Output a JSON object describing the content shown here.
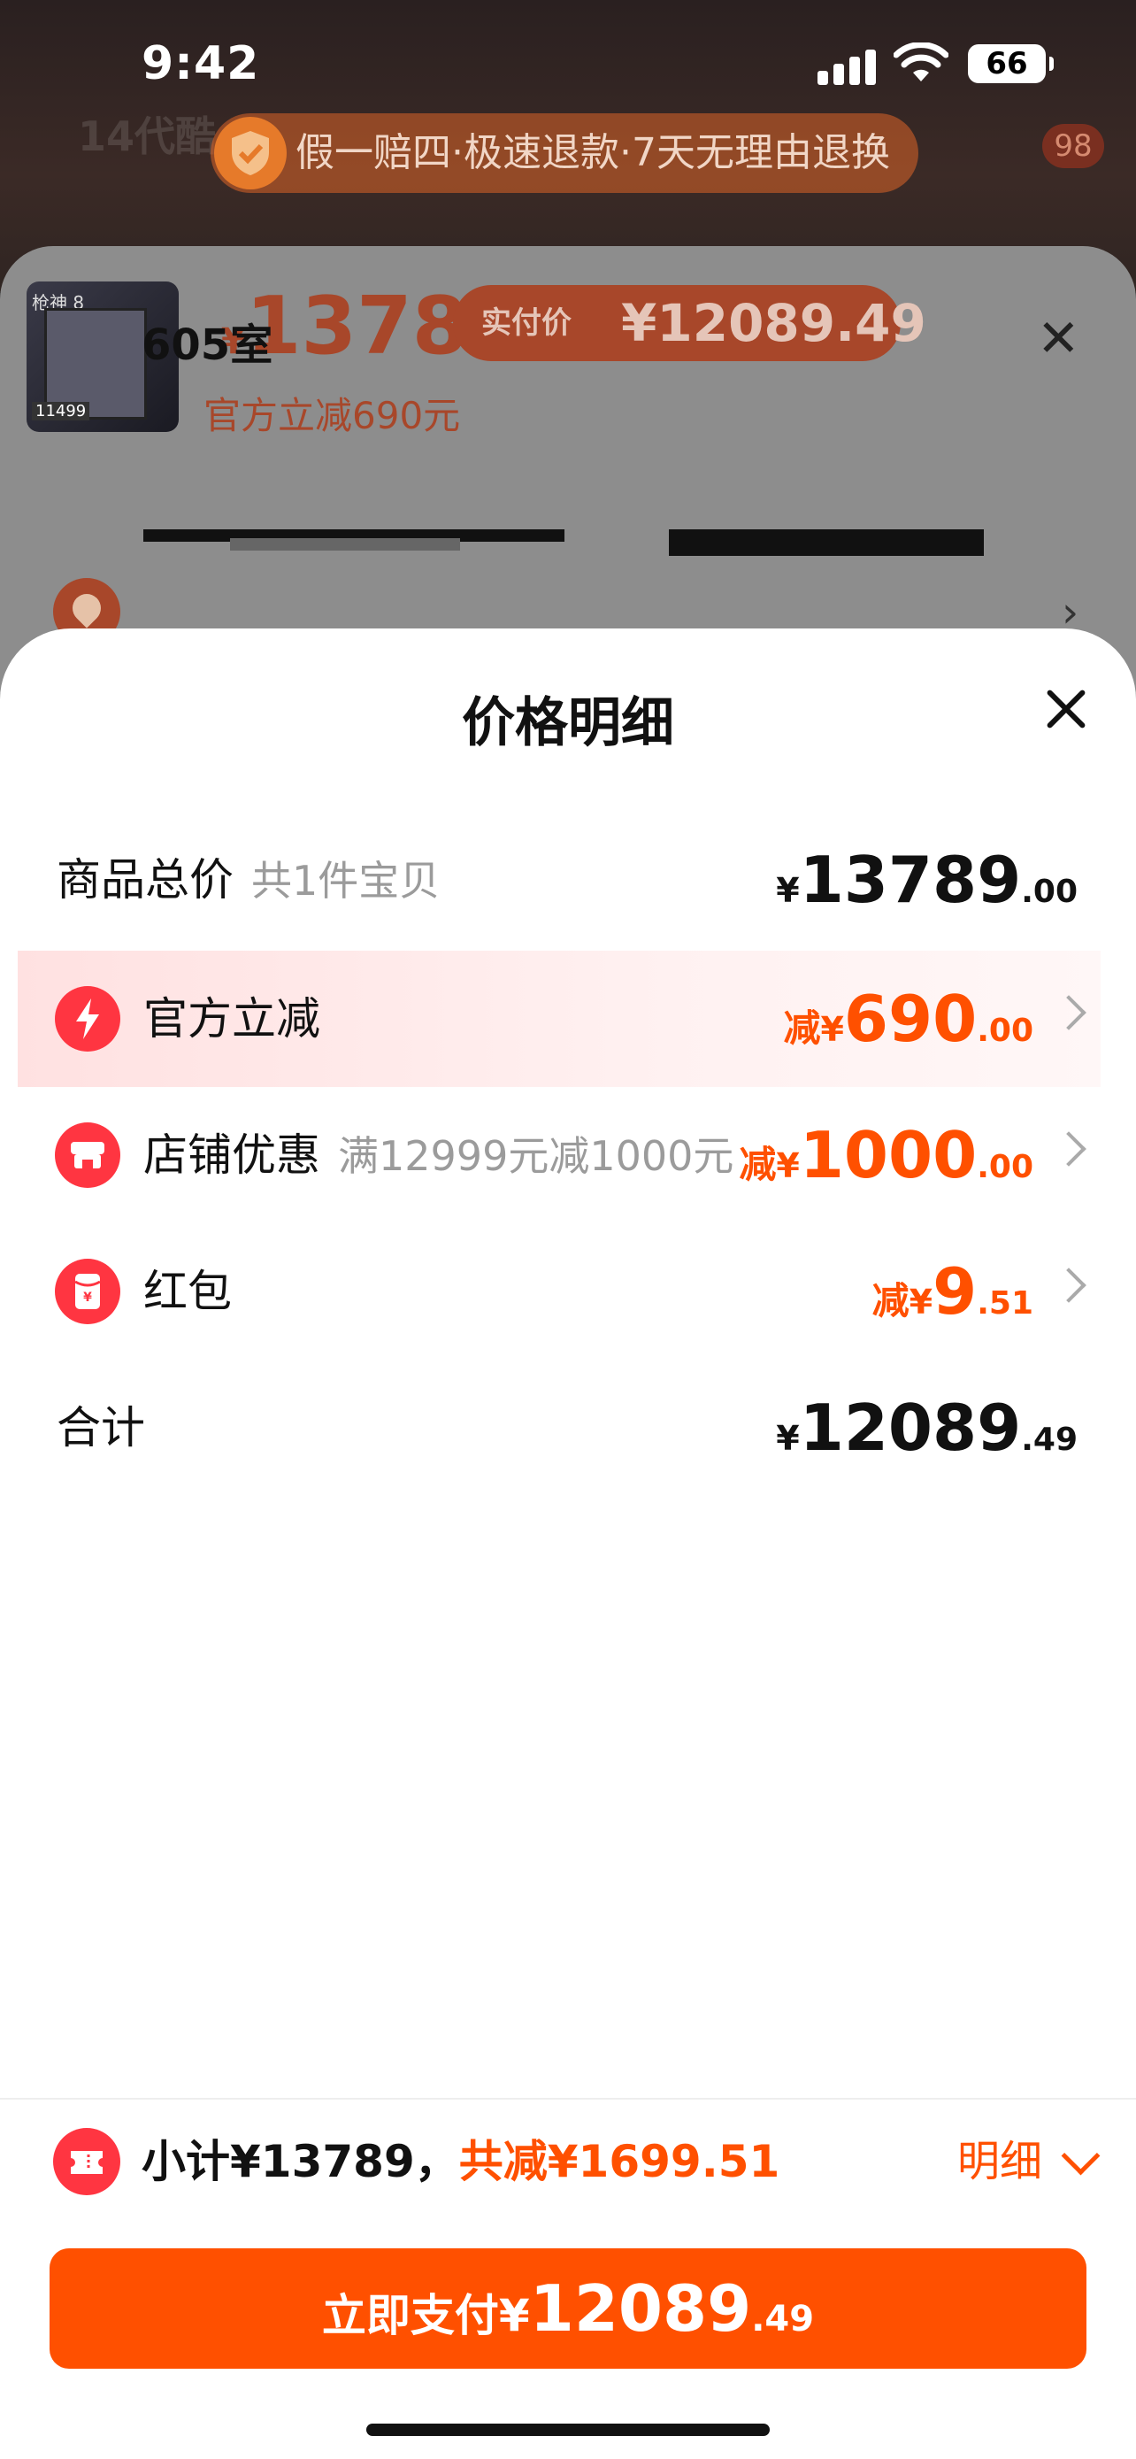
{
  "status_bar": {
    "time": "9:42",
    "battery": "66"
  },
  "background": {
    "ghost_title": "14代酷",
    "guarantee_text": "假一赔四·极速退款·7天无理由退换",
    "badge": "98",
    "product": {
      "thumb_label": "枪神 8",
      "thumb_price": "11499",
      "price_currency": "¥",
      "price": "13789",
      "pay_label": "实付价",
      "pay_price": "¥12089.49",
      "discount_text": "官方立减690元"
    },
    "address": {
      "room": "605室"
    }
  },
  "modal": {
    "title": "价格明细",
    "rows": [
      {
        "label": "商品总价",
        "sub": "共1件宝贝",
        "currency": "¥",
        "int": "13789",
        "dec": ".00"
      },
      {
        "label": "官方立减",
        "prefix": "减",
        "currency": "¥",
        "int": "690",
        "dec": ".00"
      },
      {
        "label": "店铺优惠",
        "sub": "满12999元减1000元",
        "prefix": "减",
        "currency": "¥",
        "int": "1000",
        "dec": ".00"
      },
      {
        "label": "红包",
        "prefix": "减",
        "currency": "¥",
        "int": "9",
        "dec": ".51"
      },
      {
        "label": "合计",
        "currency": "¥",
        "int": "12089",
        "dec": ".49"
      }
    ]
  },
  "footer": {
    "subtotal": "小计¥13789，",
    "saved": "共减¥1699.51",
    "detail_link": "明细",
    "pay_button": {
      "text": "立即支付¥",
      "int": "12089",
      "dec": ".49"
    }
  },
  "colors": {
    "accent": "#ff5000",
    "icon_red": "#ff3541",
    "highlight_bg": "#ffe8e8"
  }
}
